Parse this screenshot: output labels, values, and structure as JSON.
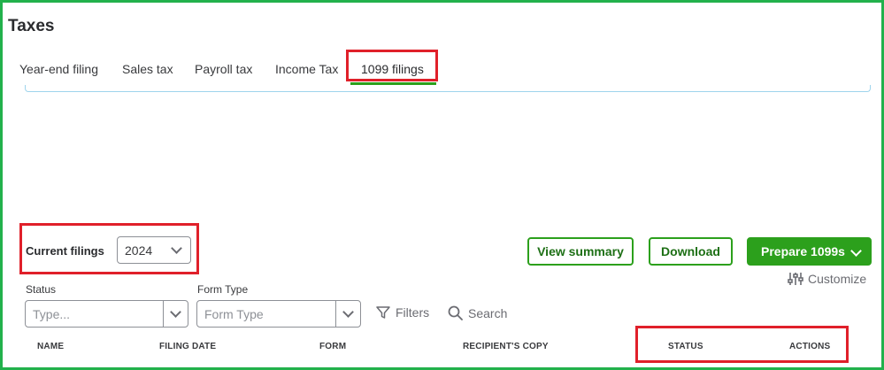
{
  "page": {
    "title": "Taxes"
  },
  "tabs": [
    {
      "label": "Year-end filing"
    },
    {
      "label": "Sales tax"
    },
    {
      "label": "Payroll tax"
    },
    {
      "label": "Income Tax"
    },
    {
      "label": "1099 filings"
    }
  ],
  "active_tab": "1099 filings",
  "filings": {
    "label": "Current filings",
    "year": "2024"
  },
  "actions": {
    "view_summary": "View summary",
    "download": "Download",
    "prepare": "Prepare 1099s",
    "customize": "Customize"
  },
  "filters": {
    "status_label": "Status",
    "status_placeholder": "Type...",
    "form_type_label": "Form Type",
    "form_type_placeholder": "Form Type",
    "filters_label": "Filters",
    "search_label": "Search"
  },
  "table": {
    "columns": [
      "NAME",
      "FILING DATE",
      "FORM",
      "RECIPIENT'S COPY",
      "STATUS",
      "ACTIONS"
    ]
  },
  "colors": {
    "brand_green": "#2ca01c",
    "annotation_red": "#e0202a",
    "frame_green": "#22b14c"
  }
}
